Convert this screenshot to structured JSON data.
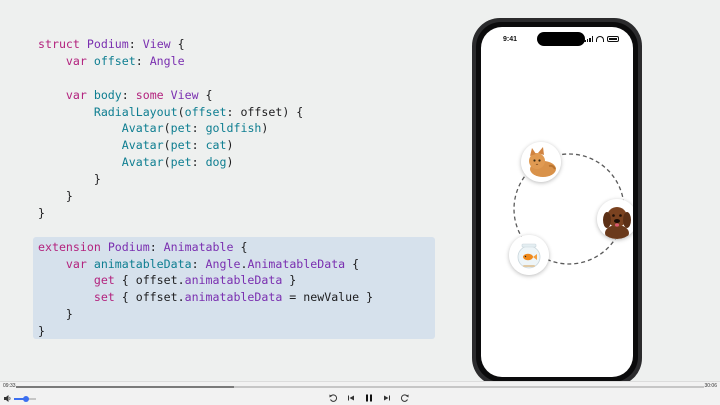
{
  "code": {
    "lines": [
      [
        [
          "struct ",
          "kw"
        ],
        [
          "Podium",
          "ty"
        ],
        [
          ": ",
          "pl"
        ],
        [
          "View",
          "ty"
        ],
        [
          " {",
          "pl"
        ]
      ],
      [
        [
          "    var ",
          "kw"
        ],
        [
          "offset",
          "fn"
        ],
        [
          ": ",
          "pl"
        ],
        [
          "Angle",
          "ty"
        ]
      ],
      [
        [
          "",
          ""
        ]
      ],
      [
        [
          "    var ",
          "kw"
        ],
        [
          "body",
          "fn"
        ],
        [
          ": ",
          "pl"
        ],
        [
          "some ",
          "kw"
        ],
        [
          "View",
          "ty"
        ],
        [
          " {",
          "pl"
        ]
      ],
      [
        [
          "        ",
          "pl"
        ],
        [
          "RadialLayout",
          "fn"
        ],
        [
          "(",
          "pl"
        ],
        [
          "offset",
          "fn"
        ],
        [
          ": offset) {",
          "pl"
        ]
      ],
      [
        [
          "            ",
          "pl"
        ],
        [
          "Avatar",
          "fn"
        ],
        [
          "(",
          "pl"
        ],
        [
          "pet",
          "fn"
        ],
        [
          ": ",
          "pl"
        ],
        [
          "goldfish",
          "fn"
        ],
        [
          ")",
          "pl"
        ]
      ],
      [
        [
          "            ",
          "pl"
        ],
        [
          "Avatar",
          "fn"
        ],
        [
          "(",
          "pl"
        ],
        [
          "pet",
          "fn"
        ],
        [
          ": ",
          "pl"
        ],
        [
          "cat",
          "fn"
        ],
        [
          ")",
          "pl"
        ]
      ],
      [
        [
          "            ",
          "pl"
        ],
        [
          "Avatar",
          "fn"
        ],
        [
          "(",
          "pl"
        ],
        [
          "pet",
          "fn"
        ],
        [
          ": ",
          "pl"
        ],
        [
          "dog",
          "fn"
        ],
        [
          ")",
          "pl"
        ]
      ],
      [
        [
          "        }",
          "pl"
        ]
      ],
      [
        [
          "    }",
          "pl"
        ]
      ],
      [
        [
          "}",
          "pl"
        ]
      ],
      [
        [
          "",
          ""
        ]
      ],
      [
        [
          "extension ",
          "kw"
        ],
        [
          "Podium",
          "ty"
        ],
        [
          ": ",
          "pl"
        ],
        [
          "Animatable",
          "ty"
        ],
        [
          " {",
          "pl"
        ]
      ],
      [
        [
          "    var ",
          "kw"
        ],
        [
          "animatableData",
          "fn"
        ],
        [
          ": ",
          "pl"
        ],
        [
          "Angle",
          "ty"
        ],
        [
          ".",
          "pl"
        ],
        [
          "AnimatableData",
          "ty"
        ],
        [
          " {",
          "pl"
        ]
      ],
      [
        [
          "        get ",
          "kw"
        ],
        [
          "{ offset.",
          "pl"
        ],
        [
          "animatableData",
          "ty"
        ],
        [
          " }",
          "pl"
        ]
      ],
      [
        [
          "        set ",
          "kw"
        ],
        [
          "{ offset.",
          "pl"
        ],
        [
          "animatableData",
          "ty"
        ],
        [
          " = newValue }",
          "pl"
        ]
      ],
      [
        [
          "    }",
          "pl"
        ]
      ],
      [
        [
          "}",
          "pl"
        ]
      ]
    ]
  },
  "phone": {
    "status_time": "9:41",
    "avatars": [
      {
        "pet": "cat",
        "icon": "cat-photo-icon"
      },
      {
        "pet": "dog",
        "icon": "dog-photo-icon"
      },
      {
        "pet": "goldfish",
        "icon": "goldfish-bowl-icon"
      }
    ]
  },
  "player": {
    "elapsed": "09:33",
    "total": "30:06",
    "progress": 0.317,
    "volume": 0.55
  },
  "colors": {
    "keyword": "#b3237e",
    "type": "#7a2fb0",
    "identifier": "#0e7e91",
    "highlight": "#d6e1ec",
    "accent": "#3c6ff0"
  }
}
